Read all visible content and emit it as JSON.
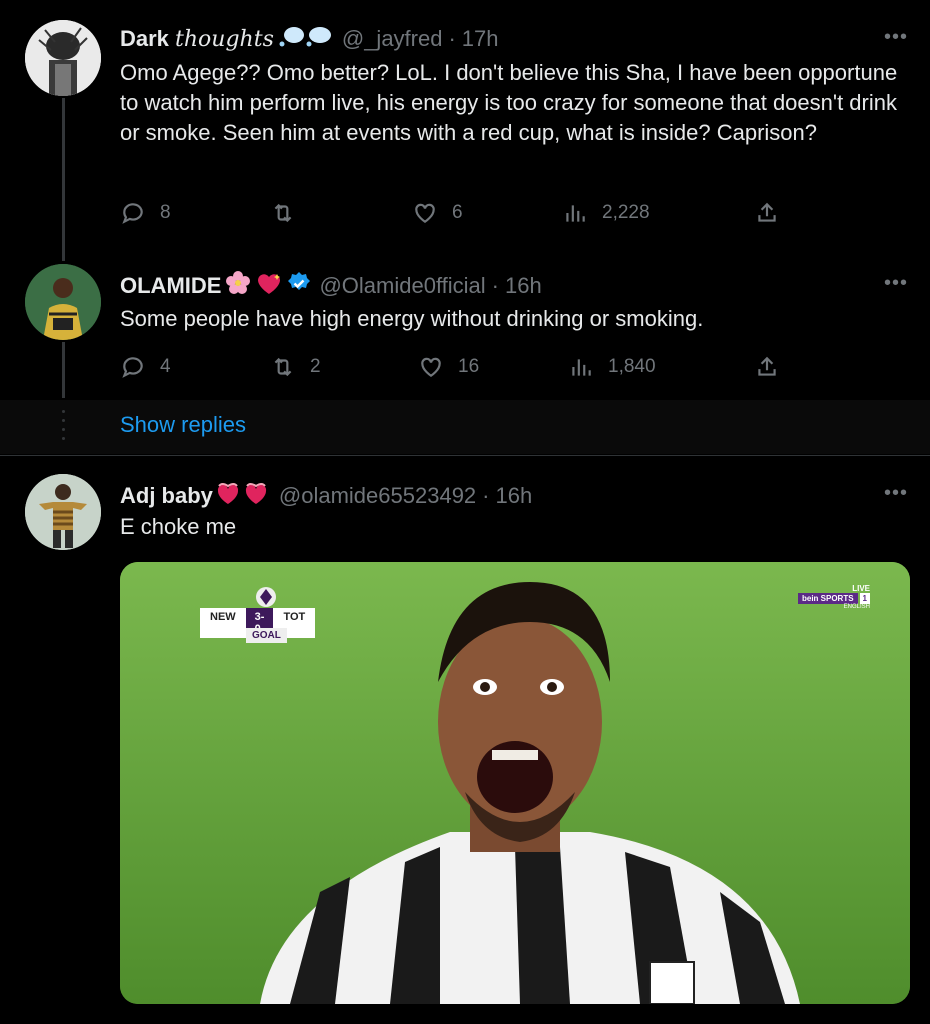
{
  "tweets": [
    {
      "name_plain": "Dark",
      "name_italic": "thoughts",
      "handle": "@_jayfred",
      "time": "17h",
      "text": "Omo Agege?? Omo better? LoL. I don't believe this Sha, I have been opportune to watch him perform live, his energy is too crazy for someone that doesn't drink or smoke. Seen him at events with a red cup, what is inside? Caprison?",
      "replies": "8",
      "retweets": "",
      "likes": "6",
      "views": "2,228"
    },
    {
      "name": "OLAMIDE",
      "handle": "@Olamide0fficial",
      "time": "16h",
      "text": "Some people have high energy without drinking or smoking.",
      "replies": "4",
      "retweets": "2",
      "likes": "16",
      "views": "1,840"
    },
    {
      "name": "Adj baby",
      "handle": "@olamide65523492",
      "time": "16h",
      "text": "E choke me"
    }
  ],
  "show_replies": "Show replies",
  "media": {
    "home": "NEW",
    "score": "3-0",
    "away": "TOT",
    "event": "GOAL",
    "broadcaster": "bein SPORTS",
    "channel": "1",
    "live": "LIVE",
    "language": "ENGLISH"
  },
  "colors": {
    "accent": "#1d9bf0",
    "muted": "#71767b",
    "text": "#e7e9ea",
    "background": "#000000"
  }
}
